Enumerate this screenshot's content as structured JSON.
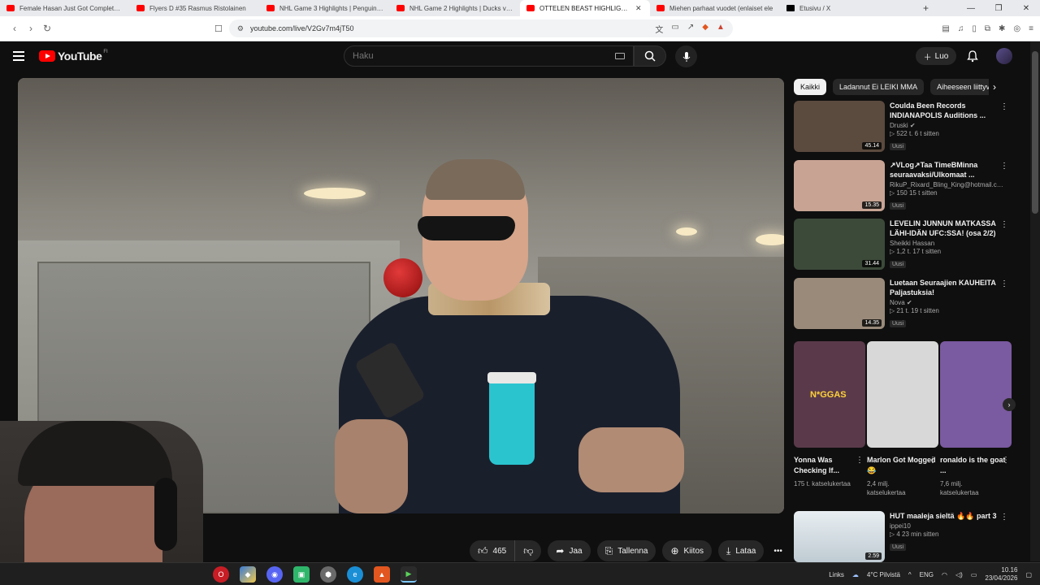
{
  "browser": {
    "tabs": [
      {
        "title": "Female Hasan Just Got Completely D",
        "favicon": "youtube",
        "active": false
      },
      {
        "title": "Flyers D #35 Rasmus Ristolainen",
        "favicon": "youtube",
        "active": false
      },
      {
        "title": "NHL Game 3 Highlights | Penguins vs",
        "favicon": "youtube",
        "active": false
      },
      {
        "title": "NHL Game 2 Highlights | Ducks vs. O",
        "favicon": "youtube",
        "active": false
      },
      {
        "title": "OTTELEN BEAST HIGHLIGHTS!",
        "favicon": "youtube",
        "active": true
      },
      {
        "title": "Miehen parhaat vuodet (enlaiset ele",
        "favicon": "youtube",
        "active": false
      },
      {
        "title": "Etusivu / X",
        "favicon": "x",
        "active": false
      }
    ],
    "new_tab": "+",
    "window_controls": [
      "—",
      "❐",
      "✕"
    ],
    "url": "youtube.com/live/V2Gv7m4jT50"
  },
  "youtube": {
    "logo_text": "YouTube",
    "country_code": "FI",
    "search_placeholder": "Haku",
    "create_label": "Luo"
  },
  "actions": {
    "like_count": "465",
    "share": "Jaa",
    "save": "Tallenna",
    "thanks": "Kiitos",
    "download": "Lataa"
  },
  "chips": [
    "Kaikki",
    "Ladannut Ei LEIKI MMA",
    "Aiheeseen liittyvät"
  ],
  "recommendations": [
    {
      "title": "Coulda Been Records INDIANAPOLIS Auditions ...",
      "channel": "Druski",
      "verified": true,
      "stats": "522 t.   6 t sitten",
      "badge": "Uusi",
      "duration": "45.14",
      "thumb_color": "#5b4a3e"
    },
    {
      "title": "↗VLog↗Taa TimeBMinna seuraavaksi/Ulkomaat ...",
      "channel": "RikuP_Rixard_Bling_King@hotmail.com...",
      "verified": false,
      "stats": "150   15 t sitten",
      "badge": "Uusi",
      "duration": "15.35",
      "thumb_color": "#c8a393"
    },
    {
      "title": "LEVELIN JUNNUN MATKASSA LÄHI-IDÄN UFC:SSA! (osa 2/2)",
      "channel": "Sheikki Hassan",
      "verified": false,
      "stats": "1,2 t.   17 t sitten",
      "badge": "Uusi",
      "duration": "31.44",
      "thumb_color": "#3c4a3a"
    },
    {
      "title": "Luetaan Seuraajien KAUHEITA Paljastuksia!",
      "channel": "Nova",
      "verified": true,
      "stats": "21 t.   19 t sitten",
      "badge": "Uusi",
      "duration": "14.35",
      "thumb_color": "#9a8a7a"
    }
  ],
  "shorts": [
    {
      "title": "Yonna Was Checking If...",
      "views": "175 t. katselukertaa",
      "overlay": "N*GGAS",
      "thumb_color": "#5a3a4a"
    },
    {
      "title": "Marlon Got Mogged 😂",
      "views": "2,4 milj. katselukertaa",
      "overlay": "",
      "thumb_color": "#d8d8d8"
    },
    {
      "title": "ronaldo is the goat ...",
      "views": "7,6 milj. katselukertaa",
      "overlay": "",
      "thumb_color": "#7a5aa0"
    }
  ],
  "bottom_rec": {
    "title": "HUT maaleja sieltä 🔥🔥 part 3",
    "channel": "ippei10",
    "stats": "4   23 min sitten",
    "badge": "Uusi",
    "duration": "2.59"
  },
  "taskbar": {
    "links": "Links",
    "weather": "4°C  Pilvistä",
    "lang": "ENG",
    "time": "10.16",
    "date": "23/04/2026"
  }
}
